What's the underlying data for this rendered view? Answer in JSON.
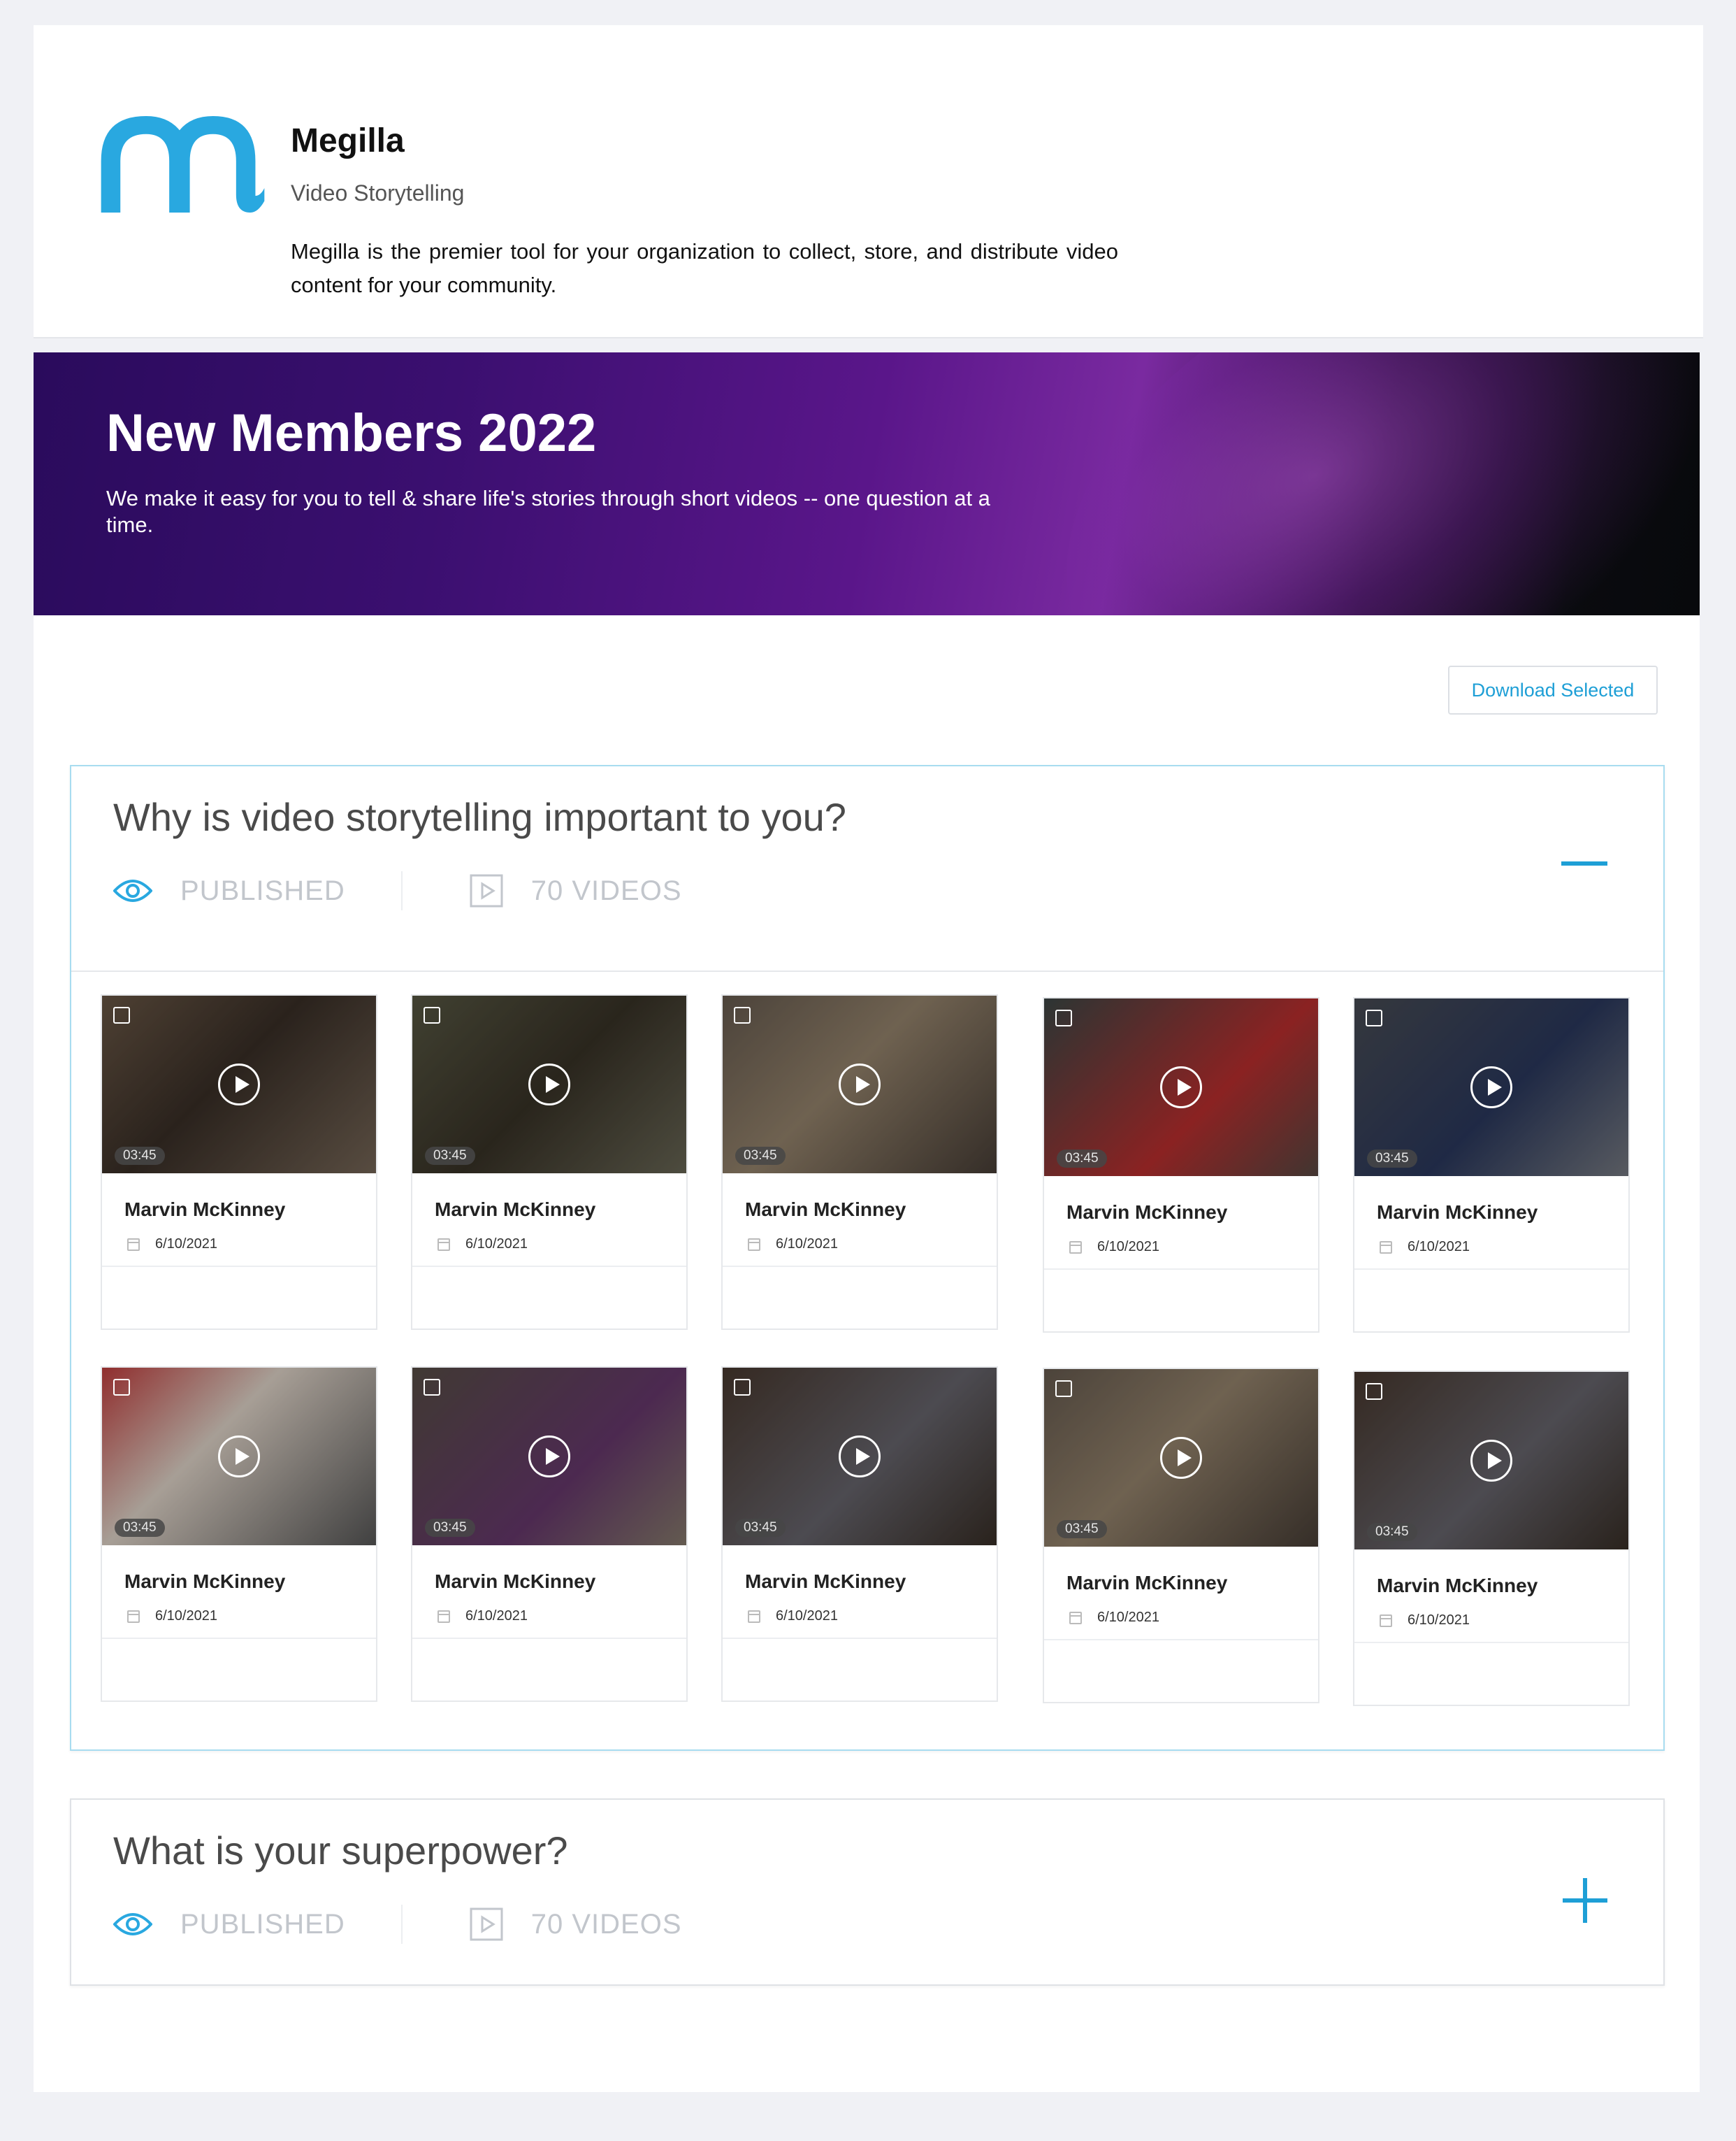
{
  "brand": {
    "name": "Megilla",
    "tagline": "Video Storytelling",
    "description": "Megilla is the premier tool for your organization to collect, store, and distribute video content for your community.",
    "logo_color": "#29a8e0"
  },
  "banner": {
    "title": "New Members 2022",
    "subtitle": "We make it easy for you to tell & share life's stories through short videos -- one question at a time."
  },
  "toolbar": {
    "download_label": "Download Selected"
  },
  "accent": "#1e9fd6",
  "questions": [
    {
      "title": "Why is video storytelling important to you?",
      "status": "PUBLISHED",
      "video_count": "70 VIDEOS",
      "expanded": true,
      "videos": [
        {
          "name": "Marvin McKinney",
          "date": "6/10/2021",
          "duration": "03:45"
        },
        {
          "name": "Marvin McKinney",
          "date": "6/10/2021",
          "duration": "03:45"
        },
        {
          "name": "Marvin McKinney",
          "date": "6/10/2021",
          "duration": "03:45"
        },
        {
          "name": "Marvin McKinney",
          "date": "6/10/2021",
          "duration": "03:45"
        },
        {
          "name": "Marvin McKinney",
          "date": "6/10/2021",
          "duration": "03:45"
        },
        {
          "name": "Marvin McKinney",
          "date": "6/10/2021",
          "duration": "03:45"
        },
        {
          "name": "Marvin McKinney",
          "date": "6/10/2021",
          "duration": "03:45"
        },
        {
          "name": "Marvin McKinney",
          "date": "6/10/2021",
          "duration": "03:45"
        },
        {
          "name": "Marvin McKinney",
          "date": "6/10/2021",
          "duration": "03:45"
        },
        {
          "name": "Marvin McKinney",
          "date": "6/10/2021",
          "duration": "03:45"
        }
      ]
    },
    {
      "title": "What is your superpower?",
      "status": "PUBLISHED",
      "video_count": "70 VIDEOS",
      "expanded": false
    }
  ]
}
